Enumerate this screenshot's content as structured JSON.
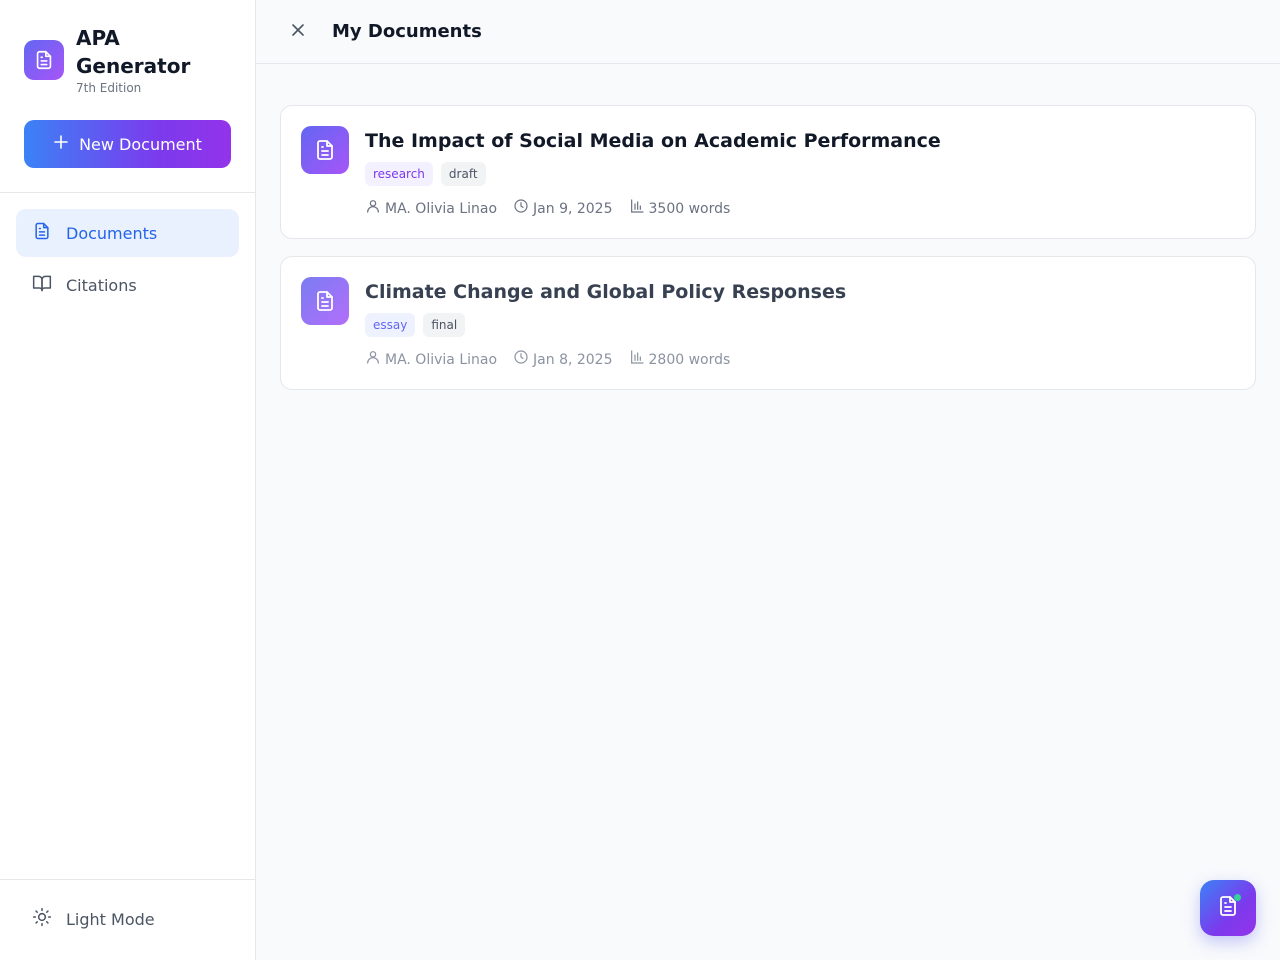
{
  "brand": {
    "title": "APA Generator",
    "edition": "7th Edition",
    "logo_icon": "document-icon"
  },
  "sidebar": {
    "new_document_label": "New Document",
    "items": [
      {
        "label": "Documents",
        "icon": "document-icon",
        "active": true
      },
      {
        "label": "Citations",
        "icon": "book-open-icon",
        "active": false
      }
    ],
    "theme_toggle_label": "Light Mode"
  },
  "header": {
    "title": "My Documents"
  },
  "documents": [
    {
      "title": "The Impact of Social Media on Academic Performance",
      "tags": [
        "research",
        "draft"
      ],
      "author": "MA. Olivia Linao",
      "date": "Jan 9, 2025",
      "words": "3500 words"
    },
    {
      "title": "Climate Change and Global Policy Responses",
      "tags": [
        "essay",
        "final"
      ],
      "author": "MA. Olivia Linao",
      "date": "Jan 8, 2025",
      "words": "2800 words"
    }
  ],
  "colors": {
    "accent": "#2563eb",
    "brand_gradient_start": "#6366f1",
    "brand_gradient_end": "#a855f7",
    "active_nav_bg": "#eaf1fe"
  }
}
